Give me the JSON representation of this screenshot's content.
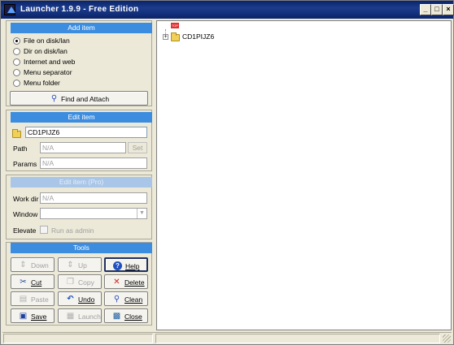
{
  "window": {
    "title": "Launcher 1.9.9 - Free Edition",
    "controls": {
      "minimize": "_",
      "maximize": "□",
      "close": "×"
    }
  },
  "add_item": {
    "header": "Add item",
    "options": [
      {
        "label": "File on disk/lan",
        "checked": true
      },
      {
        "label": "Dir on disk/lan",
        "checked": false
      },
      {
        "label": "Internet and web",
        "checked": false
      },
      {
        "label": "Menu separator",
        "checked": false
      },
      {
        "label": "Menu folder",
        "checked": false
      }
    ],
    "find_attach_label": "Find and Attach"
  },
  "edit_item": {
    "header": "Edit item",
    "name_value": "CD1PIJZ6",
    "path_label": "Path",
    "path_value": "N/A",
    "set_label": "Set",
    "params_label": "Params",
    "params_value": "N/A"
  },
  "edit_item_pro": {
    "header": "Edit item (Pro)",
    "workdir_label": "Work dir",
    "workdir_value": "N/A",
    "window_label": "Window",
    "window_value": "",
    "elevate_label": "Elevate",
    "run_as_admin_label": "Run as admin"
  },
  "tools": {
    "header": "Tools",
    "buttons": {
      "down": "Down",
      "up": "Up",
      "help": "Help",
      "cut": "Cut",
      "copy": "Copy",
      "delete": "Delete",
      "paste": "Paste",
      "undo": "Undo",
      "clean": "Clean",
      "save": "Save",
      "launch": "Launch",
      "close": "Close"
    }
  },
  "tree": {
    "top_badge": "TOP",
    "expander": "+",
    "items": [
      {
        "label": "CD1PIJZ6"
      }
    ]
  },
  "colors": {
    "section_header": "#3c8de0",
    "section_header_disabled": "#a9c6e8",
    "titlebar": "#0a246a"
  }
}
